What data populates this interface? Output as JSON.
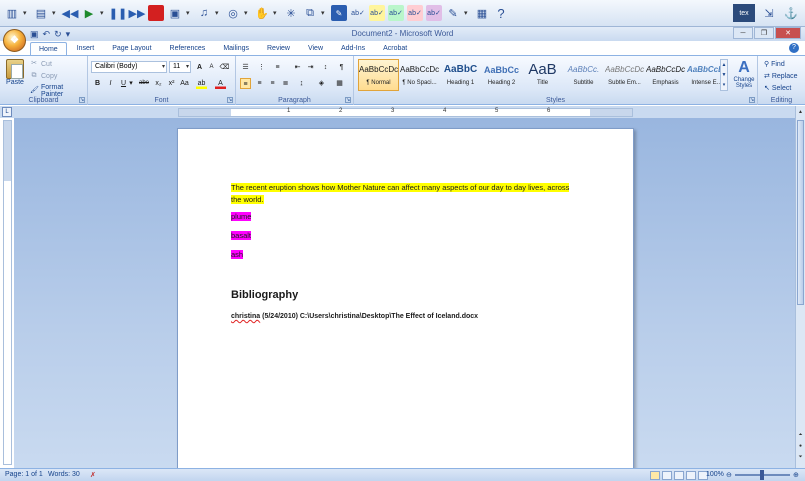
{
  "window": {
    "title": "Document2 - Microsoft Word"
  },
  "ext_toolbar": {
    "tex_label": "tex",
    "icons": [
      "toolbar-app-icon",
      "tool-icon",
      "rewind-icon",
      "play-icon",
      "pause-icon",
      "fast-forward-icon",
      "stop-icon",
      "screen-icon",
      "audio-icon",
      "globe-icon",
      "hand-icon",
      "star-icon",
      "layers-icon",
      "dictionary-icon",
      "spell-check-icon",
      "spell-check-yellow-icon",
      "spell-check-green-icon",
      "spell-check-red-icon",
      "spell-check-purple-icon",
      "highlight-icon",
      "calculator-icon",
      "help-icon"
    ]
  },
  "tabs": [
    "Home",
    "Insert",
    "Page Layout",
    "References",
    "Mailings",
    "Review",
    "View",
    "Add-Ins",
    "Acrobat"
  ],
  "clipboard": {
    "paste": "Paste",
    "cut": "Cut",
    "copy": "Copy",
    "format_painter": "Format Painter",
    "label": "Clipboard"
  },
  "font": {
    "name": "Calibri (Body)",
    "size": "11",
    "label": "Font",
    "grow": "A",
    "shrink": "A",
    "bold": "B",
    "italic": "I",
    "underline": "U",
    "strike": "abe",
    "subscript": "x₂",
    "superscript": "x²",
    "change_case": "Aa",
    "font_color": "A"
  },
  "paragraph": {
    "label": "Paragraph"
  },
  "styles": {
    "label": "Styles",
    "items": [
      {
        "sample": "AaBbCcDc",
        "name": "¶ Normal"
      },
      {
        "sample": "AaBbCcDc",
        "name": "¶ No Spaci..."
      },
      {
        "sample": "AaBbC",
        "name": "Heading 1"
      },
      {
        "sample": "AaBbCc",
        "name": "Heading 2"
      },
      {
        "sample": "AaB",
        "name": "Title"
      },
      {
        "sample": "AaBbCc.",
        "name": "Subtitle"
      },
      {
        "sample": "AaBbCcDc",
        "name": "Subtle Em..."
      },
      {
        "sample": "AaBbCcDc",
        "name": "Emphasis"
      },
      {
        "sample": "AaBbCcDc",
        "name": "Intense E..."
      }
    ],
    "change_styles": "Change Styles"
  },
  "editing": {
    "find": "Find",
    "replace": "Replace",
    "select": "Select",
    "label": "Editing"
  },
  "document": {
    "paragraph1": "The recent eruption shows how Mother Nature can affect many aspects of our day to day lives, across the world.",
    "word1": "plume",
    "word2": "basalt",
    "word3": "ash",
    "bib_heading": "Bibliography",
    "bib_author": "christina",
    "bib_rest": " (5/24/2010)  C:\\Users\\christina\\Desktop\\The Effect of Iceland.docx"
  },
  "status": {
    "page": "Page: 1 of 1",
    "words": "Words: 30",
    "zoom": "100%"
  },
  "colors": {
    "highlight_yellow": "#ffff00",
    "highlight_magenta": "#ff00ff"
  }
}
